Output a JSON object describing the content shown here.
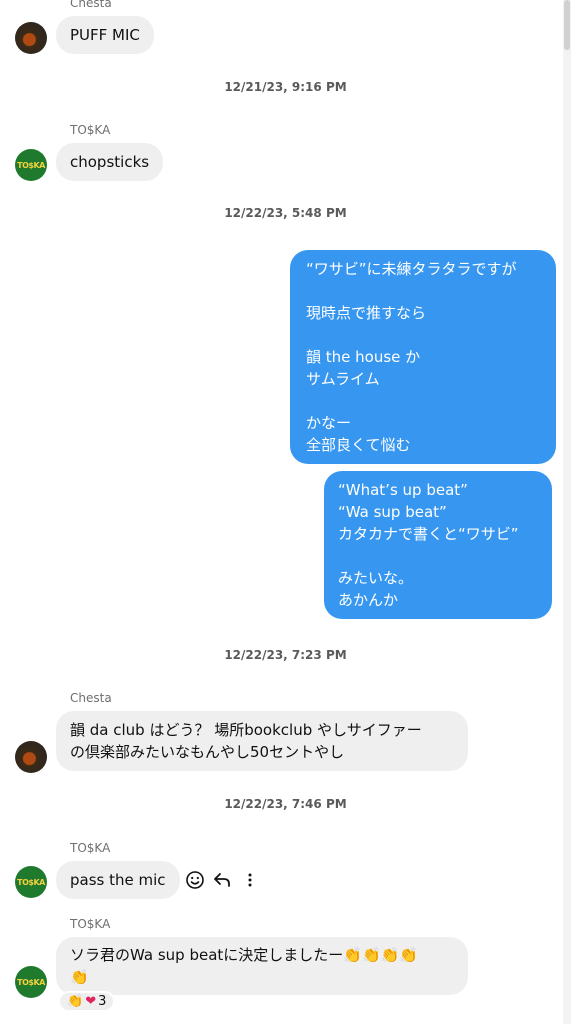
{
  "messages": [
    {
      "sender": "Chesta",
      "text": "PUFF MIC"
    },
    {
      "timestamp": "12/21/23, 9:16 PM"
    },
    {
      "sender": "TO$KA",
      "text": "chopsticks"
    },
    {
      "timestamp": "12/22/23, 5:48 PM"
    },
    {
      "out_lines_1": [
        "“ワサビ”に未練タラタラですが",
        "",
        "現時点で推すなら",
        "",
        "韻 the house か",
        "サムライム",
        "",
        "かなー",
        "全部良くて悩む"
      ]
    },
    {
      "out_lines_2": [
        "“What’s up beat”",
        "“Wa sup beat”",
        "カタカナで書くと“ワサビ”",
        "",
        "みたいな。",
        "あかんか"
      ]
    },
    {
      "timestamp": "12/22/23, 7:23 PM"
    },
    {
      "sender": "Chesta",
      "lines": [
        "韻 da club はどう？ 場所bookclub やしサイファー",
        "の倶楽部みたいなもんやし50セントやし"
      ]
    },
    {
      "timestamp": "12/22/23, 7:46 PM"
    },
    {
      "sender": "TO$KA",
      "text": "pass the mic"
    },
    {
      "sender": "TO$KA",
      "lines": [
        "ソラ君のWa sup beatに決定しましたー👏👏👏👏",
        "👏"
      ],
      "reaction_count": "3"
    }
  ],
  "avatar_text": "TO$KA",
  "icons": {
    "emoji": "smiley-icon",
    "reply": "reply-icon",
    "more": "more-icon"
  },
  "colors": {
    "outgoing": "#3797f0",
    "incoming": "#efefef"
  }
}
